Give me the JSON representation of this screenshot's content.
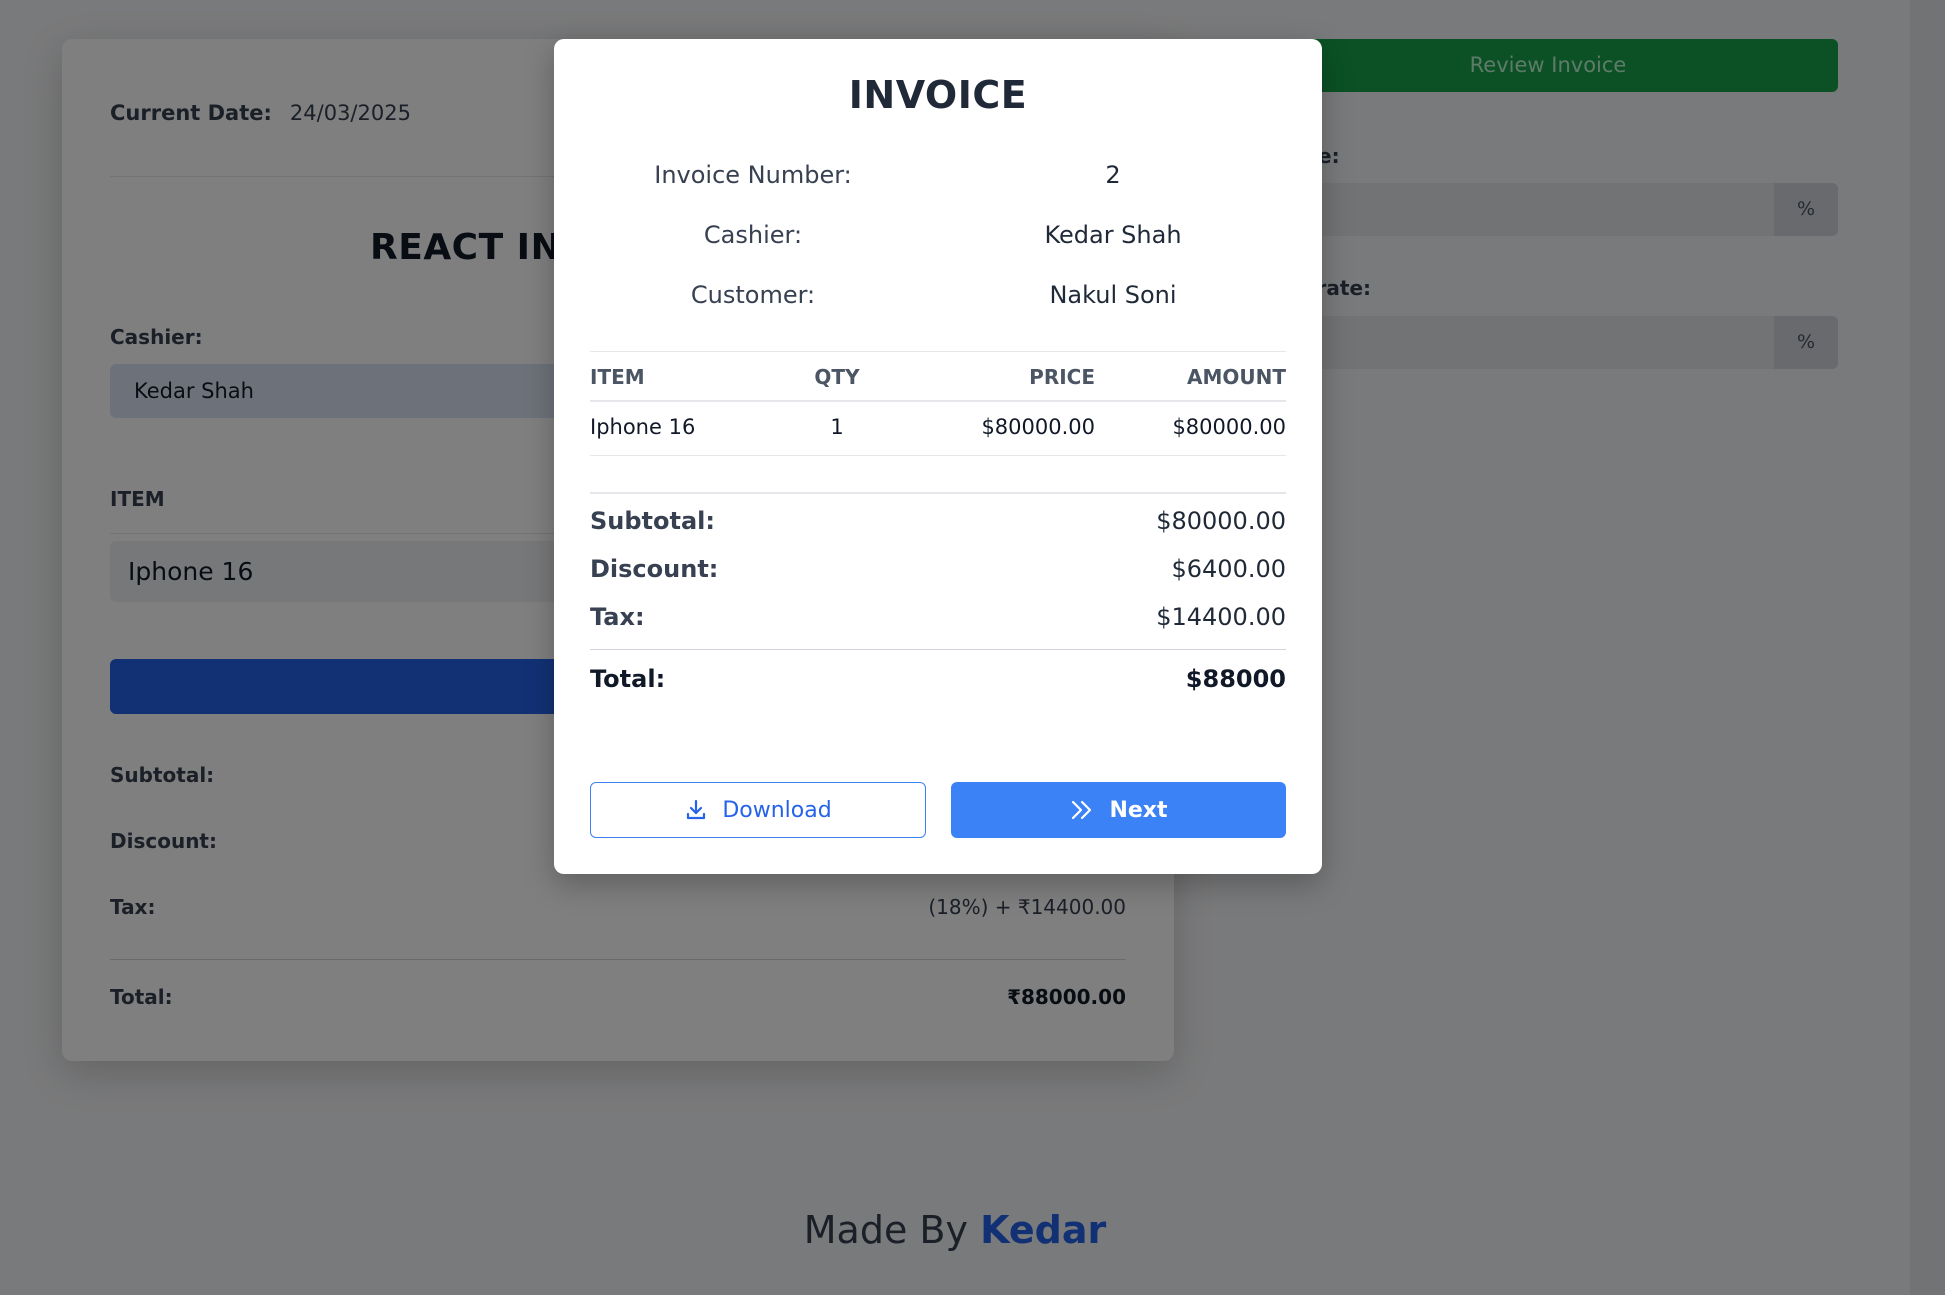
{
  "background": {
    "date_label": "Current Date:",
    "date_value": "24/03/2025",
    "title": "REACT INV",
    "cashier_label": "Cashier:",
    "cashier_value": "Kedar Shah",
    "item_header": "ITEM",
    "item_value": "Iphone 16",
    "summary": {
      "subtotal_label": "Subtotal:",
      "discount_label": "Discount:",
      "tax_label": "Tax:",
      "tax_value": "(18%) + ₹14400.00",
      "total_label": "Total:",
      "total_value": "₹88000.00"
    },
    "sidebar": {
      "review_button": "Review Invoice",
      "rate_label_1": "e:",
      "rate_label_2": "t rate:",
      "percent_symbol_1": "%",
      "percent_symbol_2": "%"
    },
    "footer": {
      "prefix": "Made By",
      "name": "Kedar"
    }
  },
  "modal": {
    "title": "INVOICE",
    "meta": {
      "invoice_number_label": "Invoice Number:",
      "invoice_number_value": "2",
      "cashier_label": "Cashier:",
      "cashier_value": "Kedar Shah",
      "customer_label": "Customer:",
      "customer_value": "Nakul Soni"
    },
    "table": {
      "headers": {
        "item": "ITEM",
        "qty": "QTY",
        "price": "PRICE",
        "amount": "AMOUNT"
      },
      "rows": [
        {
          "item": "Iphone 16",
          "qty": "1",
          "price": "$80000.00",
          "amount": "$80000.00"
        }
      ]
    },
    "summary": {
      "subtotal_label": "Subtotal:",
      "subtotal_value": "$80000.00",
      "discount_label": "Discount:",
      "discount_value": "$6400.00",
      "tax_label": "Tax:",
      "tax_value": "$14400.00",
      "total_label": "Total:",
      "total_value": "$88000"
    },
    "buttons": {
      "download_label": "Download",
      "download_icon": "download-icon",
      "next_label": "Next",
      "next_icon": "double-chevron-right-icon"
    }
  },
  "colors": {
    "accent_blue": "#3b82f6",
    "review_green": "#16a34a",
    "overlay": "rgba(0,0,0,0.5)"
  }
}
